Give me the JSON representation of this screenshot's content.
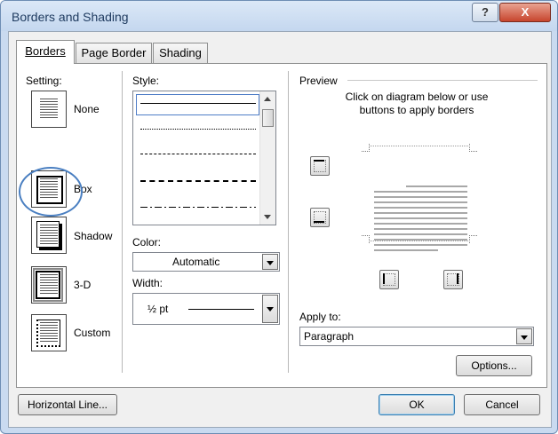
{
  "window": {
    "title": "Borders and Shading",
    "help_label": "?",
    "close_label": "X"
  },
  "tabs": [
    {
      "label": "Borders",
      "active": true
    },
    {
      "label": "Page Border",
      "active": false
    },
    {
      "label": "Shading",
      "active": false
    }
  ],
  "setting": {
    "heading": "Setting:",
    "items": [
      {
        "label": "None",
        "icon": "none-setting-icon"
      },
      {
        "label": "Box",
        "icon": "box-setting-icon",
        "highlighted": true
      },
      {
        "label": "Shadow",
        "icon": "shadow-setting-icon"
      },
      {
        "label": "3-D",
        "icon": "3d-setting-icon"
      },
      {
        "label": "Custom",
        "icon": "custom-setting-icon"
      }
    ]
  },
  "style": {
    "heading": "Style:",
    "options": [
      "solid",
      "dotted",
      "dashed-small",
      "dashed",
      "dash-dot"
    ],
    "selected": "solid"
  },
  "color": {
    "label": "Color:",
    "value": "Automatic"
  },
  "width": {
    "label": "Width:",
    "value": "½ pt"
  },
  "preview": {
    "heading": "Preview",
    "instruction": "Click on diagram below or use buttons to apply borders"
  },
  "apply_to": {
    "label": "Apply to:",
    "value": "Paragraph"
  },
  "buttons": {
    "options": "Options...",
    "horizontal_line": "Horizontal Line...",
    "ok": "OK",
    "cancel": "Cancel"
  },
  "colors": {
    "titlebar": "#c4d7ef",
    "close_button": "#c7452d",
    "highlight": "#4a7fc1",
    "dialog_bg": "#f0f0f0"
  }
}
